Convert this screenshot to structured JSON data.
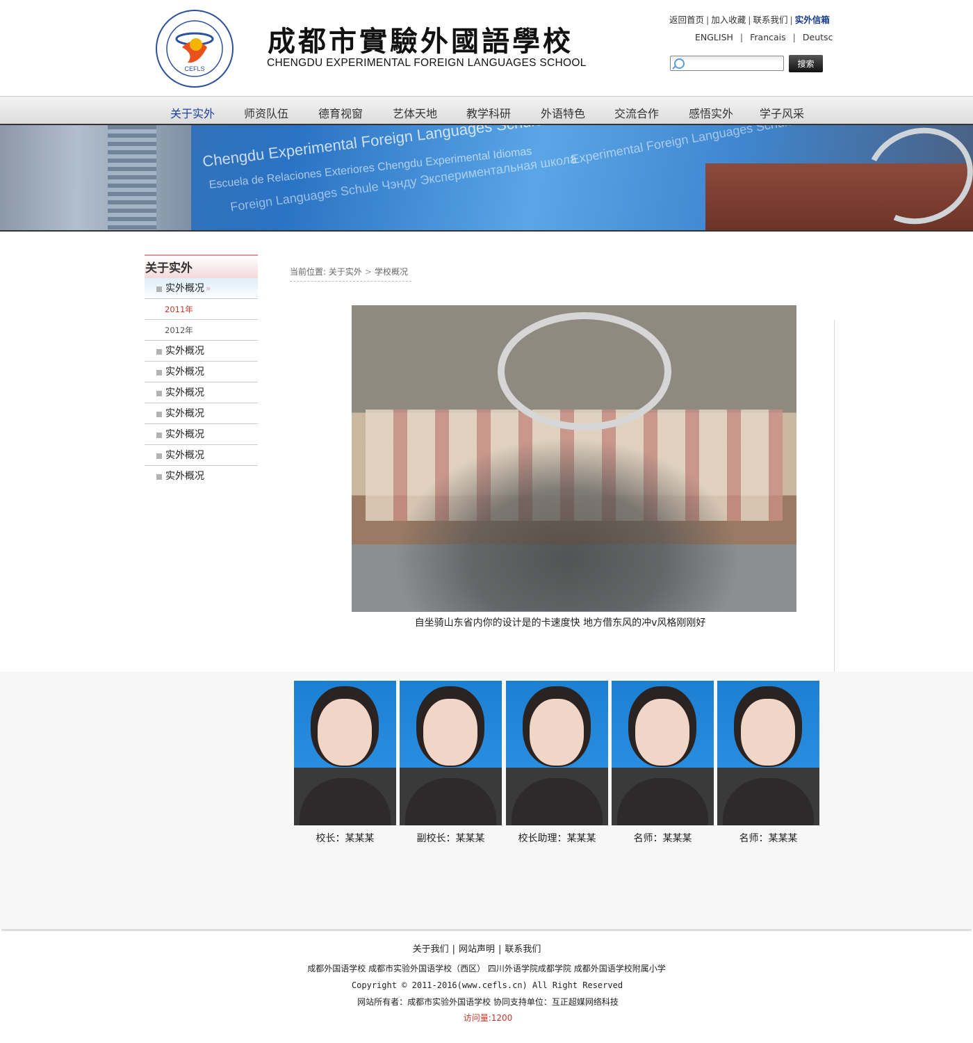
{
  "header": {
    "logo_cn": "成都市實驗外國語學校",
    "logo_en": "CHENGDU EXPERIMENTAL FOREIGN LANGUAGES SCHOOL",
    "logo_seal_text": "CEFLS",
    "top_links": [
      "返回首页",
      "加入收藏",
      "联系我们",
      "实外信箱"
    ],
    "languages": [
      "ENGLISH",
      "Francais",
      "Deutsc"
    ],
    "search": {
      "placeholder": "",
      "button": "搜索"
    }
  },
  "nav": {
    "items": [
      "关于实外",
      "师资队伍",
      "德育视窗",
      "艺体天地",
      "教学科研",
      "外语特色",
      "交流合作",
      "感悟实外",
      "学子风采"
    ],
    "active_index": 0
  },
  "sidebar": {
    "title": "关于实外",
    "items": [
      {
        "label": "实外概况",
        "active": true,
        "children": [
          "2011年",
          "2012年"
        ]
      },
      {
        "label": "实外概况"
      },
      {
        "label": "实外概况"
      },
      {
        "label": "实外概况"
      },
      {
        "label": "实外概况"
      },
      {
        "label": "实外概况"
      },
      {
        "label": "实外概况"
      },
      {
        "label": "实外概况"
      }
    ]
  },
  "breadcrumb": {
    "prefix": "当前位置:",
    "items": [
      "关于实外",
      "学校概况"
    ]
  },
  "main": {
    "photo_caption": "自坐骑山东省内你的设计是的卡速度快 地方借东风的冲v风格刚刚好",
    "staff": [
      {
        "caption": "校长：某某某"
      },
      {
        "caption": "副校长：某某某"
      },
      {
        "caption": "校长助理：某某某"
      },
      {
        "caption": "名师：某某某"
      },
      {
        "caption": "名师：某某某"
      }
    ]
  },
  "footer": {
    "links": [
      "关于我们",
      "网站声明",
      "联系我们"
    ],
    "schools": [
      "成都外国语学校",
      "成都市实验外国语学校（西区）",
      "四川外语学院成都学院",
      "成都外国语学校附属小学"
    ],
    "copyright": "Copyright © 2011-2016(www.cefls.cn) All Right Reserved",
    "owner": "网站所有者：成都市实验外国语学校 协同支持单位：互正超媒网络科技",
    "visits": "访问量:1200"
  }
}
